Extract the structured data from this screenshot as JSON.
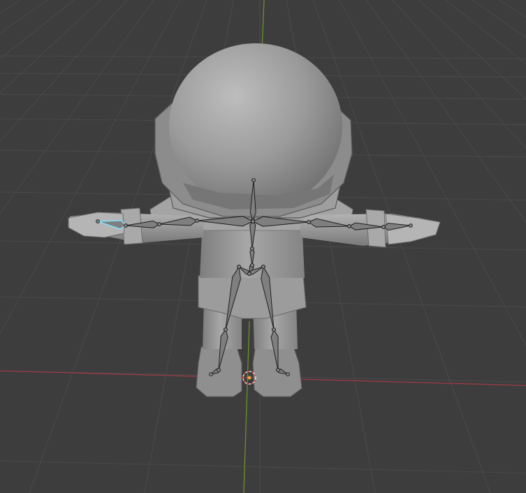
{
  "viewport": {
    "editor": "3D Viewport",
    "background_color": "#3d3d3d",
    "grid_color": "#4a4a4a",
    "x_axis_color": "#9b3a46",
    "y_axis_color": "#6f8f2f"
  },
  "scene": {
    "mesh_object": "astronaut-mesh",
    "mesh_color": "#9a9a9a",
    "armature_object": "armature",
    "active_bone": "left-hand-bone",
    "active_bone_color": "#7fe4ff",
    "cursor": "3d-cursor-icon"
  }
}
